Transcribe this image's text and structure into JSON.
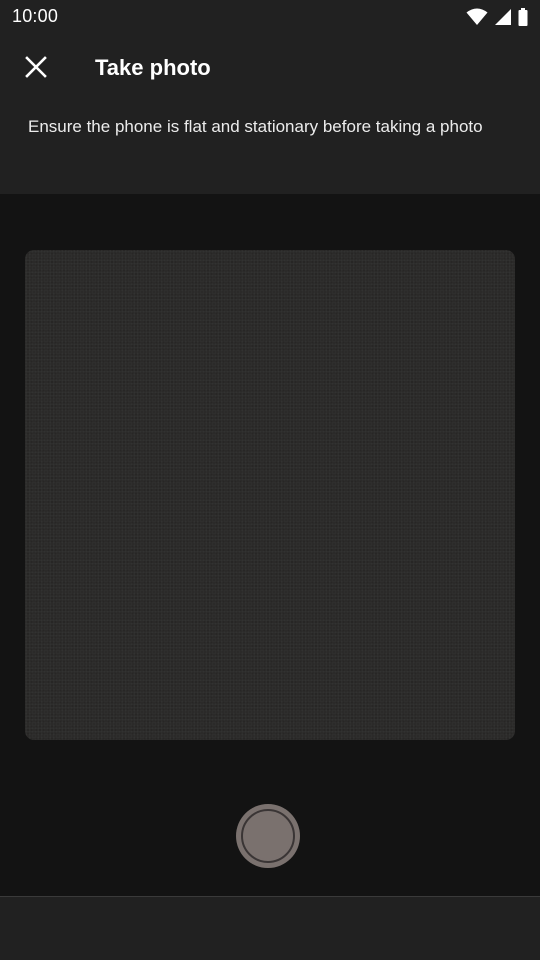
{
  "status_bar": {
    "time": "10:00",
    "icons": [
      "wifi-icon",
      "cellular-signal-icon",
      "battery-icon"
    ]
  },
  "header": {
    "close_icon": "close-icon",
    "title": "Take photo",
    "instructions": "Ensure the phone is flat and stationary before taking a photo"
  },
  "camera": {
    "shutter_icon": "shutter-button"
  },
  "colors": {
    "header_bg": "#212121",
    "screen_bg": "#131313",
    "preview_bg": "#2b2a29",
    "shutter": "#7a716e",
    "text": "#ffffff"
  }
}
